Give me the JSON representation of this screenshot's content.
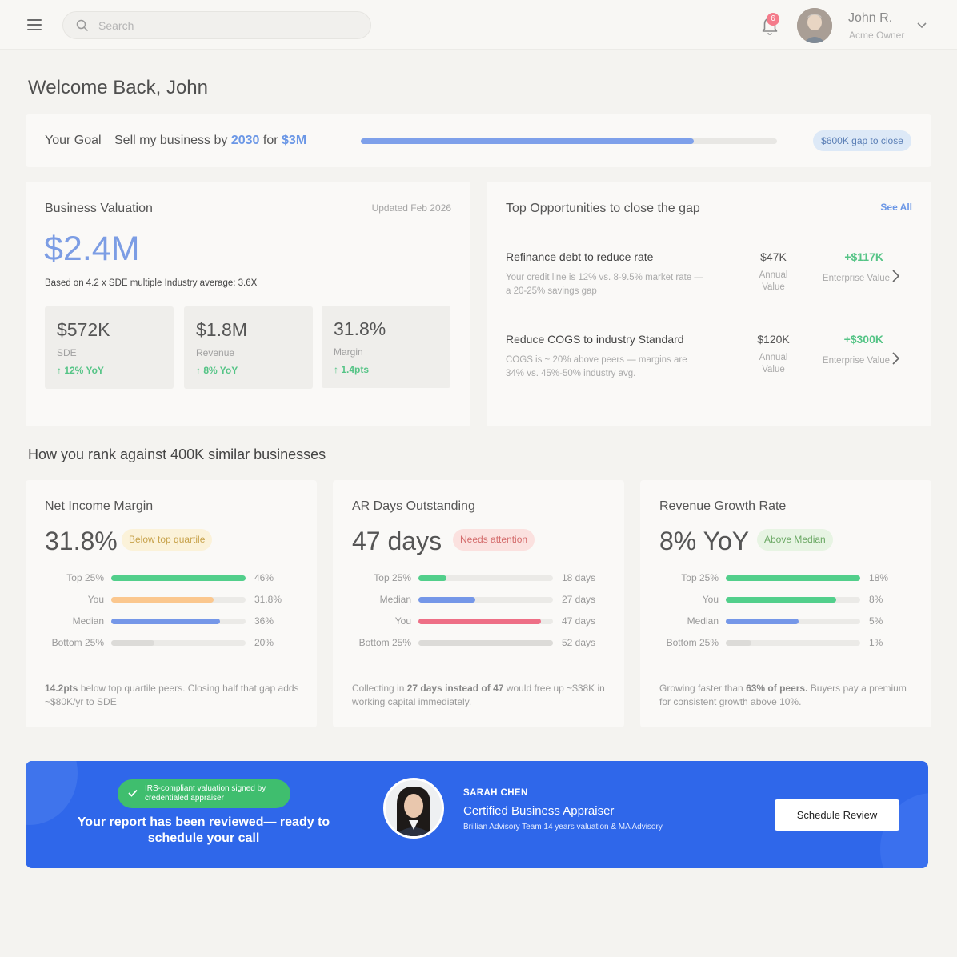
{
  "header": {
    "search_placeholder": "Search",
    "notification_count": "6",
    "user_name": "John R.",
    "user_role": "Acme Owner"
  },
  "welcome": "Welcome Back, John",
  "goal": {
    "label": "Your Goal",
    "text_prefix": "Sell my business by",
    "year": "2030",
    "text_mid": "for",
    "amount": "$3M",
    "progress": 0.8,
    "gap_label": "$600K gap to close"
  },
  "valuation": {
    "title": "Business Valuation",
    "updated": "Updated Feb 2026",
    "value": "$2.4M",
    "basis": "Based on 4.2 x SDE multiple Industry average: 3.6X",
    "metrics": [
      {
        "value": "$572K",
        "label": "SDE",
        "change": "↑ 12% YoY"
      },
      {
        "value": "$1.8M",
        "label": "Revenue",
        "change": "↑ 8% YoY"
      },
      {
        "value": "31.8%",
        "label": "Margin",
        "change": "↑ 1.4pts"
      }
    ]
  },
  "opportunities": {
    "title": "Top Opportunities to close the gap",
    "see_all": "See All",
    "annual_label": "Annual Value",
    "enterprise_label": "Enterprise Value",
    "items": [
      {
        "title": "Refinance debt to reduce rate",
        "desc": "Your credit line is 12% vs. 8-9.5% market rate — a 20-25% savings gap",
        "annual": "$47K",
        "enterprise": "+$117K"
      },
      {
        "title": "Reduce COGS to industry Standard",
        "desc": "COGS is ~ 20% above peers — margins are 34% vs. 45%-50% industry avg.",
        "annual": "$120K",
        "enterprise": "+$300K"
      }
    ]
  },
  "rank": {
    "heading": "How you rank against 400K similar businesses",
    "cards": [
      {
        "title": "Net Income Margin",
        "value": "31.8%",
        "badge": "Below top quartile",
        "rows": [
          {
            "label": "Top 25%",
            "value": "46%",
            "fill": 1.0,
            "color": "#52cf8b"
          },
          {
            "label": "You",
            "value": "31.8%",
            "fill": 0.76,
            "color": "#fbc78e"
          },
          {
            "label": "Median",
            "value": "36%",
            "fill": 0.81,
            "color": "#7597e8"
          },
          {
            "label": "Bottom 25%",
            "value": "20%",
            "fill": 0.32,
            "color": "#dcdbd8"
          }
        ],
        "note_bold": "14.2pts",
        "note_rest": " below top quartile peers. Closing half that gap adds ~$80K/yr to SDE"
      },
      {
        "title": "AR Days Outstanding",
        "value": "47 days",
        "badge": "Needs attention",
        "rows": [
          {
            "label": "Top 25%",
            "value": "18 days",
            "fill": 0.21,
            "color": "#52cf8b"
          },
          {
            "label": "Median",
            "value": "27 days",
            "fill": 0.42,
            "color": "#7597e8"
          },
          {
            "label": "You",
            "value": "47 days",
            "fill": 0.91,
            "color": "#ee6f86"
          },
          {
            "label": "Bottom 25%",
            "value": "52 days",
            "fill": 1.0,
            "color": "#dcdbd8"
          }
        ],
        "note_pre": "Collecting in ",
        "note_bold": "27 days instead of 47",
        "note_rest": " would free up ~$38K in working capital immediately."
      },
      {
        "title": "Revenue Growth Rate",
        "value": "8% YoY",
        "badge": "Above Median",
        "rows": [
          {
            "label": "Top 25%",
            "value": "18%",
            "fill": 1.0,
            "color": "#52cf8b"
          },
          {
            "label": "You",
            "value": "8%",
            "fill": 0.82,
            "color": "#52cf8b"
          },
          {
            "label": "Median",
            "value": "5%",
            "fill": 0.54,
            "color": "#7597e8"
          },
          {
            "label": "Bottom 25%",
            "value": "1%",
            "fill": 0.19,
            "color": "#dcdbd8"
          }
        ],
        "note_pre": "Growing faster than ",
        "note_bold": "63% of peers.",
        "note_rest": " Buyers pay a premium for consistent growth above 10%."
      }
    ]
  },
  "banner": {
    "badge": "IRS-compliant valuation signed by credentialed appraiser",
    "message": "Your report has been reviewed— ready to schedule your call",
    "name": "SARAH CHEN",
    "role": "Certified Business Appraiser",
    "team": "Brillian Advisory Team 14 years valuation & MA Advisory",
    "button": "Schedule Review"
  }
}
